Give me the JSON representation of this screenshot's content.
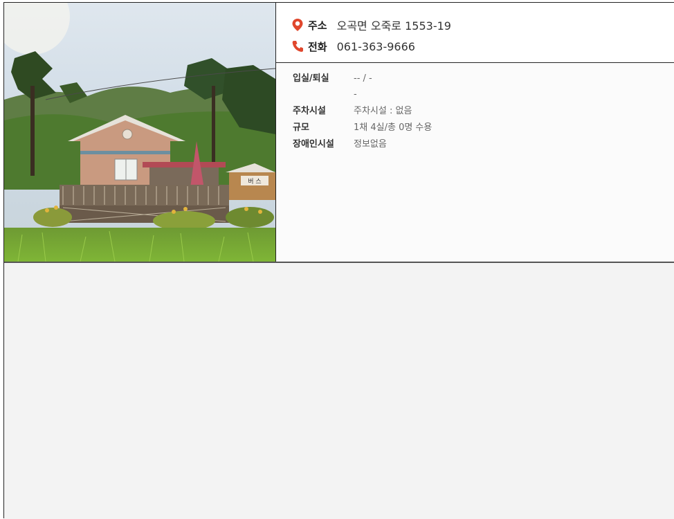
{
  "header": {
    "address_label": "주소",
    "address_value": "오곡면 오죽로 1553-19",
    "phone_label": "전화",
    "phone_value": "061-363-9666"
  },
  "details": {
    "checkin_label": "입실/퇴실",
    "checkin_value": "-- / -",
    "checkin_extra": "-",
    "parking_label": "주차시설",
    "parking_value": "주차시설 : 없음",
    "scale_label": "규모",
    "scale_value": "1채 4실/총 0명 수용",
    "accessibility_label": "장애인시설",
    "accessibility_value": "정보없음"
  },
  "photo": {
    "sign_text": "버 스"
  },
  "colors": {
    "accent": "#e0472d",
    "border": "#222222",
    "panel_bg": "#f3f3f3"
  },
  "icons": {
    "address": "map-pin-icon",
    "phone": "phone-icon"
  }
}
